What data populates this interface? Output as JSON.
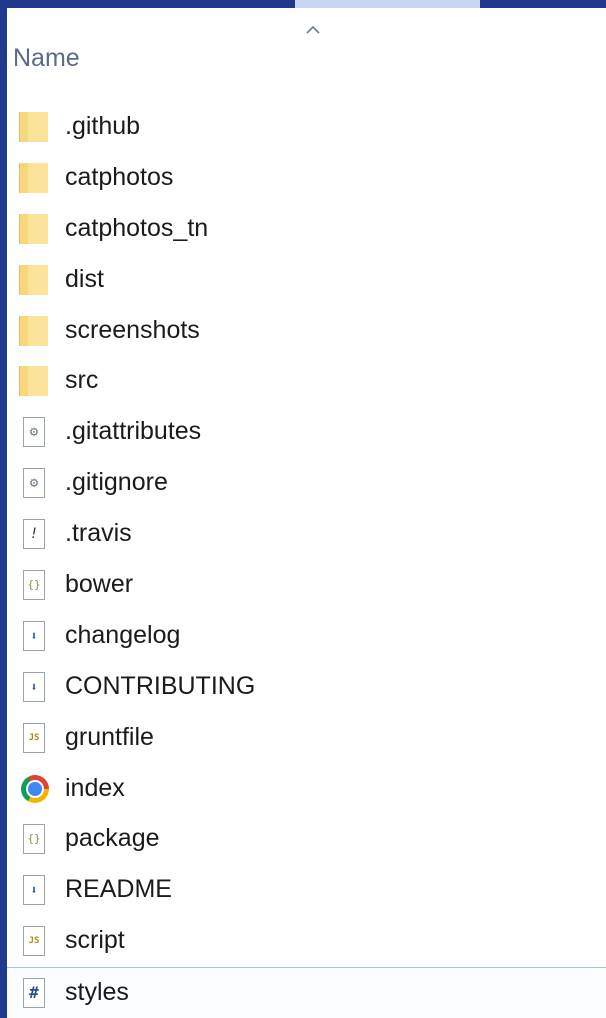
{
  "header": {
    "column_name": "Name",
    "sort_icon": "chevron-up-icon"
  },
  "files": [
    {
      "label": ".github",
      "icon": "folder-icon"
    },
    {
      "label": "catphotos",
      "icon": "folder-icon"
    },
    {
      "label": "catphotos_tn",
      "icon": "folder-icon"
    },
    {
      "label": "dist",
      "icon": "folder-icon"
    },
    {
      "label": "screenshots",
      "icon": "folder-icon"
    },
    {
      "label": "src",
      "icon": "folder-icon"
    },
    {
      "label": ".gitattributes",
      "icon": "config-file-icon"
    },
    {
      "label": ".gitignore",
      "icon": "config-file-icon"
    },
    {
      "label": ".travis",
      "icon": "yaml-file-icon"
    },
    {
      "label": "bower",
      "icon": "json-file-icon"
    },
    {
      "label": "changelog",
      "icon": "markdown-file-icon"
    },
    {
      "label": "CONTRIBUTING",
      "icon": "markdown-file-icon"
    },
    {
      "label": "gruntfile",
      "icon": "js-file-icon"
    },
    {
      "label": "index",
      "icon": "chrome-icon"
    },
    {
      "label": "package",
      "icon": "json-file-icon"
    },
    {
      "label": "README",
      "icon": "markdown-file-icon"
    },
    {
      "label": "script",
      "icon": "js-file-icon"
    },
    {
      "label": "styles",
      "icon": "css-file-icon"
    }
  ],
  "colors": {
    "background": "#1f3a8a",
    "window": "#ffffff",
    "folder": "#f7d77b",
    "header_text": "#5b6b86",
    "selection_border": "#9fc4ea"
  }
}
